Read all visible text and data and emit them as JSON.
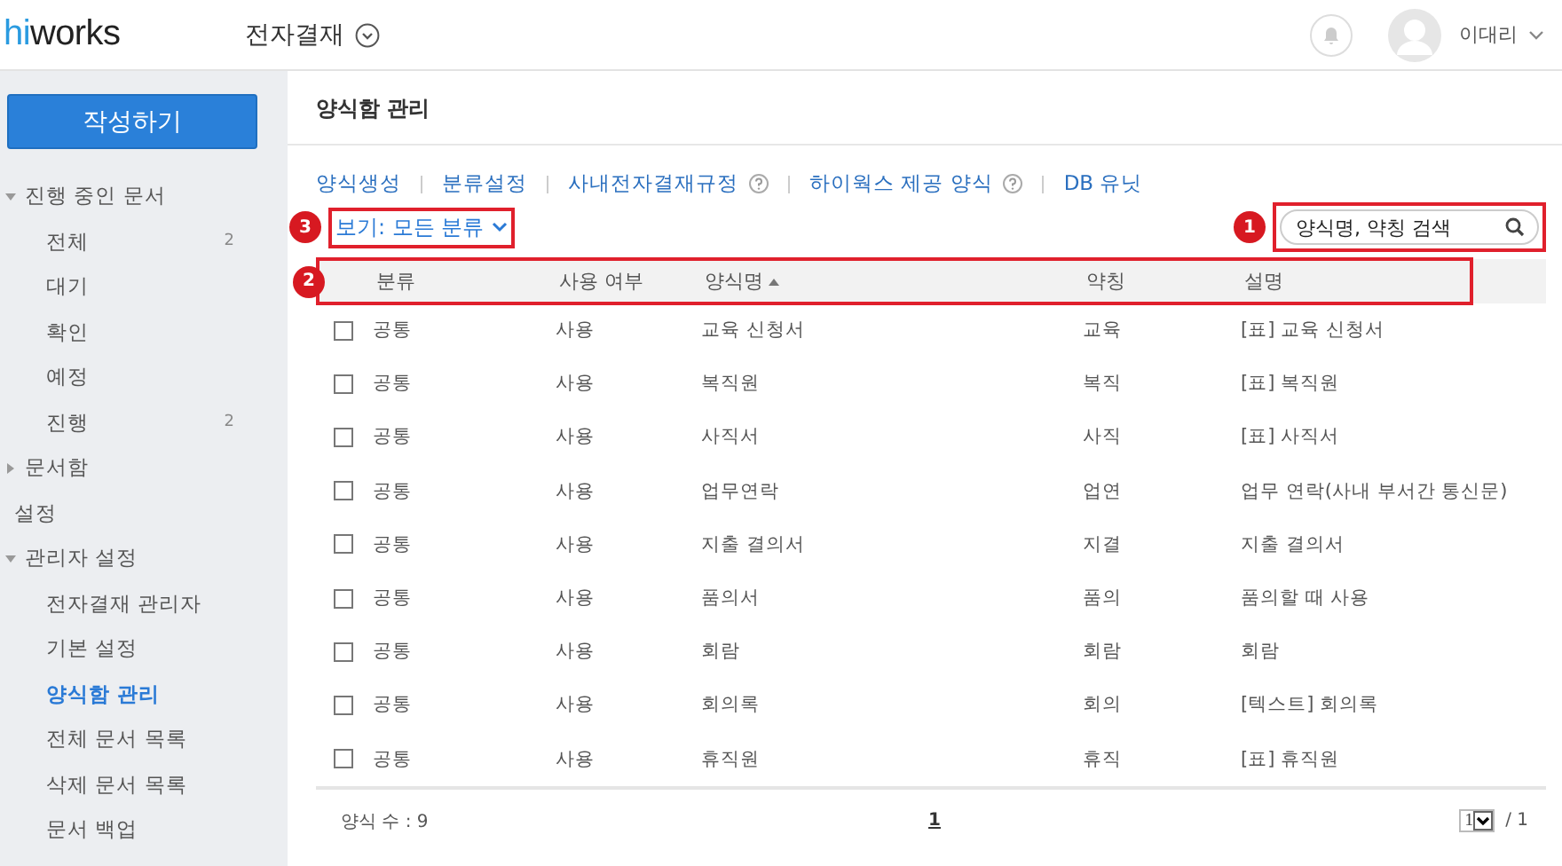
{
  "header": {
    "logo": {
      "accent": "hi",
      "rest": "works"
    },
    "app_title": "전자결재",
    "user": "이대리"
  },
  "sidebar": {
    "compose_button": "작성하기",
    "items": [
      {
        "label": "진행 중인 문서",
        "expanded": true,
        "selected": false,
        "children": [
          {
            "label": "전체",
            "count": "2",
            "selected": false
          },
          {
            "label": "대기",
            "selected": false
          },
          {
            "label": "확인",
            "selected": false
          },
          {
            "label": "예정",
            "selected": false
          },
          {
            "label": "진행",
            "count": "2",
            "selected": false
          }
        ]
      },
      {
        "label": "문서함",
        "expanded": false,
        "selected": false
      },
      {
        "label": "설정",
        "selected": false
      },
      {
        "label": "관리자 설정",
        "expanded": true,
        "selected": false,
        "children": [
          {
            "label": "전자결재 관리자",
            "selected": false
          },
          {
            "label": "기본 설정",
            "selected": false
          },
          {
            "label": "양식함 관리",
            "selected": true
          },
          {
            "label": "전체 문서 목록",
            "selected": false
          },
          {
            "label": "삭제 문서 목록",
            "selected": false
          },
          {
            "label": "문서 백업",
            "selected": false
          }
        ]
      }
    ]
  },
  "page_title": "양식함 관리",
  "links": [
    {
      "label": "양식생성",
      "help": false
    },
    {
      "label": "분류설정",
      "help": false
    },
    {
      "label": "사내전자결재규정",
      "help": true
    },
    {
      "label": "하이웍스 제공 양식",
      "help": true
    },
    {
      "label": "DB 유닛",
      "help": false
    }
  ],
  "view_filter": {
    "label": "보기: 모든 분류",
    "callout": "3"
  },
  "search": {
    "placeholder": "양식명, 약칭 검색",
    "callout": "1"
  },
  "table": {
    "callout": "2",
    "columns": [
      {
        "label": "분류",
        "sorted": false
      },
      {
        "label": "사용 여부",
        "sorted": false
      },
      {
        "label": "양식명",
        "sorted": true
      },
      {
        "label": "약칭",
        "sorted": false
      },
      {
        "label": "설명",
        "sorted": false
      }
    ],
    "rows": [
      {
        "checked": false,
        "cells": [
          "공통",
          "사용",
          "교육 신청서",
          "교육",
          "[표] 교육 신청서"
        ]
      },
      {
        "checked": false,
        "cells": [
          "공통",
          "사용",
          "복직원",
          "복직",
          "[표] 복직원"
        ]
      },
      {
        "checked": false,
        "cells": [
          "공통",
          "사용",
          "사직서",
          "사직",
          "[표] 사직서"
        ]
      },
      {
        "checked": false,
        "cells": [
          "공통",
          "사용",
          "업무연락",
          "업연",
          "업무 연락(사내 부서간 통신문)"
        ]
      },
      {
        "checked": false,
        "cells": [
          "공통",
          "사용",
          "지출 결의서",
          "지결",
          "지출 결의서"
        ]
      },
      {
        "checked": false,
        "cells": [
          "공통",
          "사용",
          "품의서",
          "품의",
          "품의할 때 사용"
        ]
      },
      {
        "checked": false,
        "cells": [
          "공통",
          "사용",
          "회람",
          "회람",
          "회람"
        ]
      },
      {
        "checked": false,
        "cells": [
          "공통",
          "사용",
          "회의록",
          "회의",
          "[텍스트] 회의록"
        ]
      },
      {
        "checked": false,
        "cells": [
          "공통",
          "사용",
          "휴직원",
          "휴직",
          "[표] 휴직원"
        ]
      }
    ]
  },
  "footer": {
    "count": "양식 수 : 9",
    "current_page": "1",
    "page_select": "1",
    "total_pages": "/ 1"
  }
}
